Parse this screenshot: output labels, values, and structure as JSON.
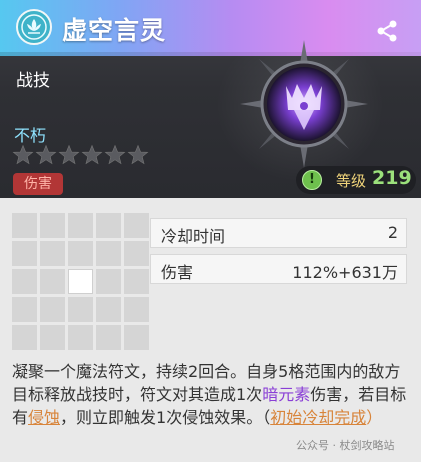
{
  "header": {
    "title": "虚空言灵",
    "category": "战技",
    "type_label": "不朽",
    "stars_total": 6,
    "stars_filled": 0,
    "tag": "伤害",
    "level_label": "等级",
    "level_value": "219",
    "colors": {
      "title_gradient_start": "#56c8f0",
      "title_gradient_end": "#d98cf0",
      "type_label": "#8fe3ff",
      "tag_bg": "#b23636",
      "level_value": "#9be07b",
      "emblem_glow": "#a05cff"
    },
    "icons": {
      "title": "lotus-icon",
      "share": "share-icon",
      "emblem": "void-crown-emblem",
      "level": "exclamation-icon"
    }
  },
  "range_grid": {
    "rows": 5,
    "cols": 5,
    "active_cells": [
      [
        2,
        2
      ]
    ]
  },
  "stats": [
    {
      "key": "冷却时间",
      "value": "2"
    },
    {
      "key": "伤害",
      "value": "112%+631万"
    }
  ],
  "description": {
    "p1": "凝聚一个魔法符文，持续2回合。自身5格范围内的敌方目标释放战技时，符文对其造成1次",
    "kw1": "暗元素",
    "p2": "伤害，若目标有",
    "kw2": "侵蚀",
    "p3": "，则立即触发1次侵蚀效果。（",
    "kw3": "初始冷却完成",
    "p4": "）"
  },
  "watermark": "公众号 · 杖剑攻略站"
}
